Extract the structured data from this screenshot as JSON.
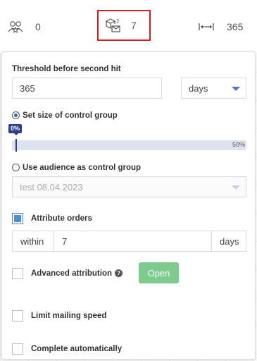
{
  "stats": {
    "users_value": "0",
    "orders_value": "7",
    "range_value": "365"
  },
  "threshold": {
    "label": "Threshold before second hit",
    "value": "365",
    "unit": "days"
  },
  "control_group_size": {
    "label": "Set size of control group",
    "selected": true,
    "slider_tip": "0%",
    "slider_value_percent": 0,
    "slider_max_label": "50%"
  },
  "audience_control": {
    "label": "Use audience as control group",
    "selected": false,
    "audience_value": "test 08.04.2023"
  },
  "attribute_orders": {
    "label": "Attribute orders",
    "checked": true,
    "within_label": "within",
    "within_value": "7",
    "unit": "days"
  },
  "advanced_attribution": {
    "label": "Advanced attribution",
    "checked": false,
    "help_glyph": "?",
    "open_label": "Open"
  },
  "limit_speed": {
    "label": "Limit mailing speed",
    "checked": false
  },
  "complete_auto": {
    "label": "Complete automatically",
    "checked": false
  },
  "colors": {
    "accent": "#2b3d8c",
    "highlight_border": "#e0191d",
    "open_button": "#7dcc8d"
  }
}
